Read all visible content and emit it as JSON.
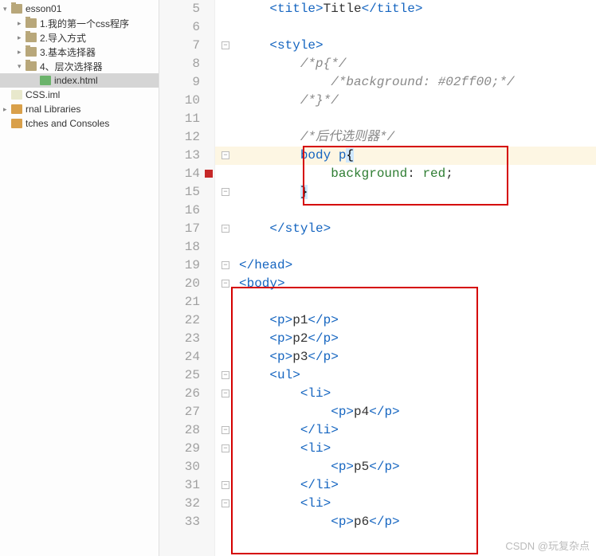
{
  "sidebar": {
    "items": [
      {
        "label": "esson01",
        "type": "folder",
        "depth": 1,
        "arrow": "▾"
      },
      {
        "label": "1.我的第一个css程序",
        "type": "folder",
        "depth": 2,
        "arrow": "▸"
      },
      {
        "label": "2.导入方式",
        "type": "folder",
        "depth": 2,
        "arrow": "▸"
      },
      {
        "label": "3.基本选择器",
        "type": "folder",
        "depth": 2,
        "arrow": "▸"
      },
      {
        "label": "4、层次选择器",
        "type": "folder",
        "depth": 2,
        "arrow": "▾"
      },
      {
        "label": "index.html",
        "type": "html",
        "depth": 3,
        "arrow": "",
        "selected": true
      },
      {
        "label": "CSS.iml",
        "type": "iml",
        "depth": 1,
        "arrow": ""
      },
      {
        "label": "rnal Libraries",
        "type": "lib",
        "depth": 1,
        "arrow": "▸"
      },
      {
        "label": "tches and Consoles",
        "type": "lib",
        "depth": 1,
        "arrow": ""
      }
    ]
  },
  "gutter": {
    "start": 5,
    "end": 33,
    "breakpoint": 14
  },
  "code": {
    "5": {
      "i": 1,
      "h": "<span class='tag'>&lt;title&gt;</span><span class='txt'>Title</span><span class='tag'>&lt;/title&gt;</span>"
    },
    "6": {
      "i": 1,
      "h": ""
    },
    "7": {
      "i": 1,
      "h": "<span class='tag'>&lt;style&gt;</span>",
      "fold": "−"
    },
    "8": {
      "i": 2,
      "h": "<span class='comment'>/*p{*/</span>"
    },
    "9": {
      "i": 3,
      "h": "<span class='comment'>/*background: #02ff00;*/</span>"
    },
    "10": {
      "i": 2,
      "h": "<span class='comment'>/*}*/</span>"
    },
    "11": {
      "i": 1,
      "h": ""
    },
    "12": {
      "i": 2,
      "h": "<span class='comment'>/*后代选则器*/</span>"
    },
    "13": {
      "i": 2,
      "h": "<span class='sel'>body p</span><span class='brace-hl'>{</span>",
      "hl": true,
      "fold": "−"
    },
    "14": {
      "i": 3,
      "h": "<span class='prop'>background</span><span class='txt'>: </span><span class='val'>red</span><span class='txt'>;</span>"
    },
    "15": {
      "i": 2,
      "h": "<span class='brace-hl'>}</span>",
      "fold": "−"
    },
    "16": {
      "i": 1,
      "h": ""
    },
    "17": {
      "i": 1,
      "h": "<span class='tag'>&lt;/style&gt;</span>",
      "fold": "−"
    },
    "18": {
      "i": 0,
      "h": ""
    },
    "19": {
      "i": 0,
      "h": "<span class='tag'>&lt;/head&gt;</span>",
      "fold": "−"
    },
    "20": {
      "i": 0,
      "h": "<span class='tag'>&lt;body&gt;</span>",
      "fold": "−"
    },
    "21": {
      "i": 0,
      "h": ""
    },
    "22": {
      "i": 1,
      "h": "<span class='tag'>&lt;p&gt;</span><span class='txt'>p1</span><span class='tag'>&lt;/p&gt;</span>"
    },
    "23": {
      "i": 1,
      "h": "<span class='tag'>&lt;p&gt;</span><span class='txt'>p2</span><span class='tag'>&lt;/p&gt;</span>"
    },
    "24": {
      "i": 1,
      "h": "<span class='tag'>&lt;p&gt;</span><span class='txt'>p3</span><span class='tag'>&lt;/p&gt;</span>"
    },
    "25": {
      "i": 1,
      "h": "<span class='tag'>&lt;ul&gt;</span>",
      "fold": "−"
    },
    "26": {
      "i": 2,
      "h": "<span class='tag'>&lt;li&gt;</span>",
      "fold": "−"
    },
    "27": {
      "i": 3,
      "h": "<span class='tag'>&lt;p&gt;</span><span class='txt'>p4</span><span class='tag'>&lt;/p&gt;</span>"
    },
    "28": {
      "i": 2,
      "h": "<span class='tag'>&lt;/li&gt;</span>",
      "fold": "−"
    },
    "29": {
      "i": 2,
      "h": "<span class='tag'>&lt;li&gt;</span>",
      "fold": "−"
    },
    "30": {
      "i": 3,
      "h": "<span class='tag'>&lt;p&gt;</span><span class='txt'>p5</span><span class='tag'>&lt;/p&gt;</span>"
    },
    "31": {
      "i": 2,
      "h": "<span class='tag'>&lt;/li&gt;</span>",
      "fold": "−"
    },
    "32": {
      "i": 2,
      "h": "<span class='tag'>&lt;li&gt;</span>",
      "fold": "−"
    },
    "33": {
      "i": 3,
      "h": "<span class='tag'>&lt;p&gt;</span><span class='txt'>p6</span><span class='tag'>&lt;/p&gt;</span>"
    }
  },
  "watermark": "CSDN @玩复杂点"
}
